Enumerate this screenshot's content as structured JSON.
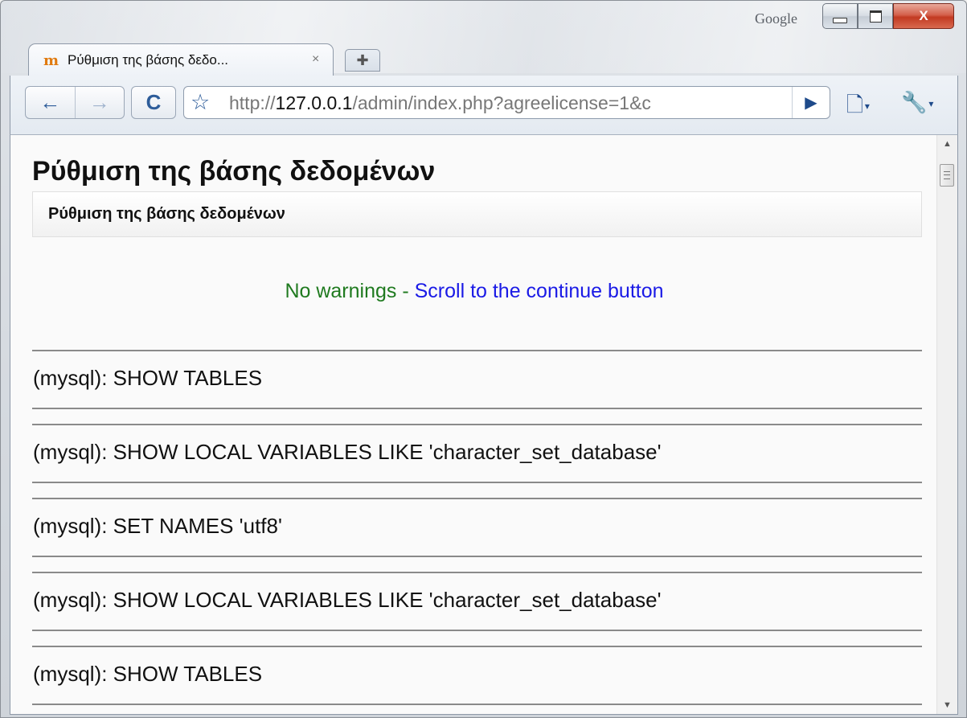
{
  "window": {
    "brand": "Google",
    "minimize_glyph": "",
    "maximize_glyph": "",
    "close_glyph": "X"
  },
  "tabs": [
    {
      "title": "Ρύθμιση της βάσης δεδο...",
      "icon": "moodle-icon",
      "close": "×"
    }
  ],
  "new_tab_glyph": "✚",
  "toolbar": {
    "back_glyph": "←",
    "forward_glyph": "→",
    "reload_glyph": "C",
    "star_glyph": "☆",
    "url_scheme": "http://",
    "url_host": "127.0.0.1",
    "url_path": "/admin/index.php?agreelicense=1&c",
    "go_glyph": "▶",
    "page_menu_glyph": "🗋",
    "wrench_glyph": "🔧",
    "caret": "▾"
  },
  "page": {
    "title": "Ρύθμιση της βάσης δεδομένων",
    "heading": "Ρύθμιση της βάσης δεδομένων",
    "notice_ok": "No warnings",
    "notice_sep": " - ",
    "notice_link": "Scroll to the continue button",
    "sql_log": [
      "(mysql): SHOW TABLES",
      "(mysql): SHOW LOCAL VARIABLES LIKE 'character_set_database'",
      "(mysql): SET NAMES 'utf8'",
      "(mysql): SHOW LOCAL VARIABLES LIKE 'character_set_database'",
      "(mysql): SHOW TABLES"
    ]
  },
  "scrollbar": {
    "up_glyph": "▲",
    "down_glyph": "▼"
  },
  "colors": {
    "notice_ok": "#1f7a1f",
    "notice_link": "#1a1ae6",
    "close_button": "#c23a22"
  }
}
